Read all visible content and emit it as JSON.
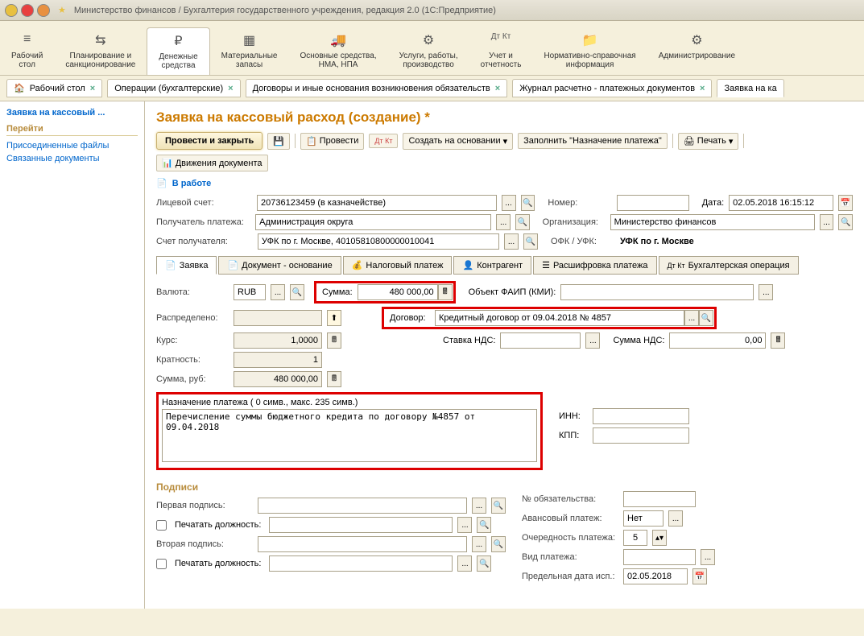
{
  "titlebar": {
    "title": "Министерство финансов / Бухгалтерия государственного учреждения, редакция 2.0  (1С:Предприятие)"
  },
  "nav": {
    "items": [
      {
        "label": "Рабочий\nстол"
      },
      {
        "label": "Планирование и\nсанкционирование"
      },
      {
        "label": "Денежные\nсредства"
      },
      {
        "label": "Материальные\nзапасы"
      },
      {
        "label": "Основные средства,\nНМА, НПА"
      },
      {
        "label": "Услуги, работы,\nпроизводство"
      },
      {
        "label": "Учет и\nотчетность"
      },
      {
        "label": "Нормативно-справочная\nинформация"
      },
      {
        "label": "Администрирование"
      }
    ]
  },
  "tabs": [
    {
      "label": "Рабочий стол"
    },
    {
      "label": "Операции (бухгалтерские)"
    },
    {
      "label": "Договоры и иные основания возникновения обязательств"
    },
    {
      "label": "Журнал расчетно - платежных документов"
    },
    {
      "label": "Заявка на ка"
    }
  ],
  "sidebar": {
    "title": "Заявка на кассовый ...",
    "heading": "Перейти",
    "links": [
      "Присоединенные файлы",
      "Связанные документы"
    ]
  },
  "page": {
    "title": "Заявка на кассовый расход (создание) *",
    "toolbar": {
      "main": "Провести и закрыть",
      "provesti": "Провести",
      "create_on": "Создать на основании",
      "fill": "Заполнить \"Назначение платежа\"",
      "print": "Печать",
      "movements": "Движения документа"
    },
    "status": "В работе",
    "fields": {
      "account_lbl": "Лицевой счет:",
      "account": "20736123459 (в казначействе)",
      "number_lbl": "Номер:",
      "number": "",
      "date_lbl": "Дата:",
      "date": "02.05.2018 16:15:12",
      "recipient_lbl": "Получатель платежа:",
      "recipient": "Администрация округа",
      "org_lbl": "Организация:",
      "org": "Министерство финансов",
      "recip_acc_lbl": "Счет получателя:",
      "recip_acc": "УФК по г. Москве, 40105810800000010041",
      "ofk_lbl": "ОФК / УФК:",
      "ofk": "УФК по г. Москве"
    },
    "subtabs": [
      "Заявка",
      "Документ - основание",
      "Налоговый платеж",
      "Контрагент",
      "Расшифровка платежа",
      "Бухгалтерская операция"
    ],
    "app": {
      "currency_lbl": "Валюта:",
      "currency": "RUB",
      "sum_lbl": "Сумма:",
      "sum": "480 000,00",
      "faip_lbl": "Объект ФАИП (КМИ):",
      "faip": "",
      "distributed_lbl": "Распределено:",
      "distributed": "",
      "contract_lbl": "Договор:",
      "contract": "Кредитный договор от 09.04.2018 № 4857",
      "rate_lbl": "Курс:",
      "rate": "1,0000",
      "vat_rate_lbl": "Ставка НДС:",
      "vat_rate": "",
      "vat_sum_lbl": "Сумма НДС:",
      "vat_sum": "0,00",
      "mult_lbl": "Кратность:",
      "mult": "1",
      "sum_rub_lbl": "Сумма, руб:",
      "sum_rub": "480 000,00",
      "purpose_lbl": "Назначение платежа ( 0 симв., макс. 235 симв.)",
      "purpose": "Перечисление суммы бюджетного кредита по договору №4857 от 09.04.2018",
      "inn_lbl": "ИНН:",
      "inn": "",
      "kpp_lbl": "КПП:",
      "kpp": ""
    },
    "sign": {
      "title": "Подписи",
      "sig1_lbl": "Первая подпись:",
      "print_pos_lbl": "Печатать должность:",
      "sig2_lbl": "Вторая подпись:",
      "oblig_no_lbl": "№ обязательства:",
      "advance_lbl": "Авансовый платеж:",
      "advance": "Нет",
      "priority_lbl": "Очередность платежа:",
      "priority": "5",
      "pay_type_lbl": "Вид платежа:",
      "deadline_lbl": "Предельная дата исп.:",
      "deadline": "02.05.2018"
    }
  }
}
